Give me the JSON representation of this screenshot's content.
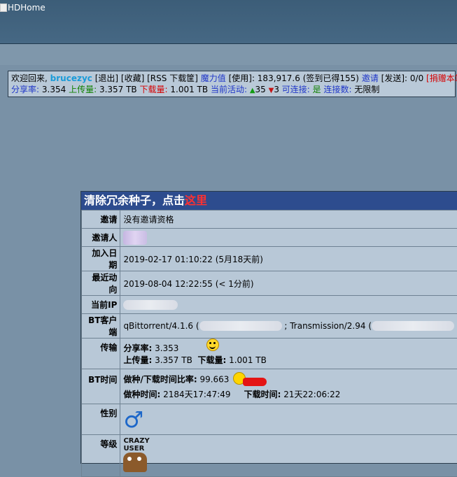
{
  "header": {
    "logo_alt": "HDHome"
  },
  "userbar": {
    "welcome": "欢迎回来,",
    "username": "brucezyc",
    "logout": "[退出]",
    "favorites": "[收藏]",
    "rss": "[RSS 下载筐]",
    "bonus_label": "魔力值",
    "use": "[使用]",
    "bonus_value": ": 183,917.6",
    "signin": "(签到已得155)",
    "invite": "邀请",
    "send": "[发送]",
    "invite_value": ": 0/0",
    "donate": "[捐赠本站]",
    "ratio_label": "分享率:",
    "ratio_value": "3.354",
    "upload_label": "上传量:",
    "upload_value": "3.357 TB",
    "download_label": "下载量:",
    "download_value": "1.001 TB",
    "active_label": "当前活动:",
    "seeding": "35",
    "leeching": "3",
    "connectable_label": "可连接:",
    "connectable_value": "是",
    "connections_label": "连接数:",
    "connections_value": "无限制"
  },
  "panel": {
    "title_prefix": "清除冗余种子，点击",
    "title_link": "这里",
    "rows": {
      "invite_label": "邀请",
      "invite_value": "没有邀请资格",
      "inviter_label": "邀请人",
      "joined_label": "加入日期",
      "joined_value": "2019-02-17 01:10:22 (5月18天前)",
      "last_action_label": "最近动向",
      "last_action_value": "2019-08-04 12:22:55 (< 1分前)",
      "ip_label": "当前IP",
      "client_label": "BT客户端",
      "client_a": "qBittorrent/4.1.6 (",
      "client_mid": "; Transmission/2.94 (",
      "transfer_label": "传输",
      "t_ratio_label": "分享率:",
      "t_ratio_value": "3.353",
      "t_upload_label": "上传量:",
      "t_upload_value": "3.357 TB",
      "t_download_label": "下载量:",
      "t_download_value": "1.001 TB",
      "bt_time_label": "BT时间",
      "bt_ratio_label": "做种/下载时间比率:",
      "bt_ratio_value": "99.663",
      "seed_time_label": "做种时间:",
      "seed_time_value": "2184天17:47:49",
      "dl_time_label": "下载时间:",
      "dl_time_value": "21天22:06:22",
      "gender_label": "性别",
      "class_label": "等级",
      "class_badge_top": "CRAZY",
      "class_badge_bottom": "USER"
    }
  }
}
